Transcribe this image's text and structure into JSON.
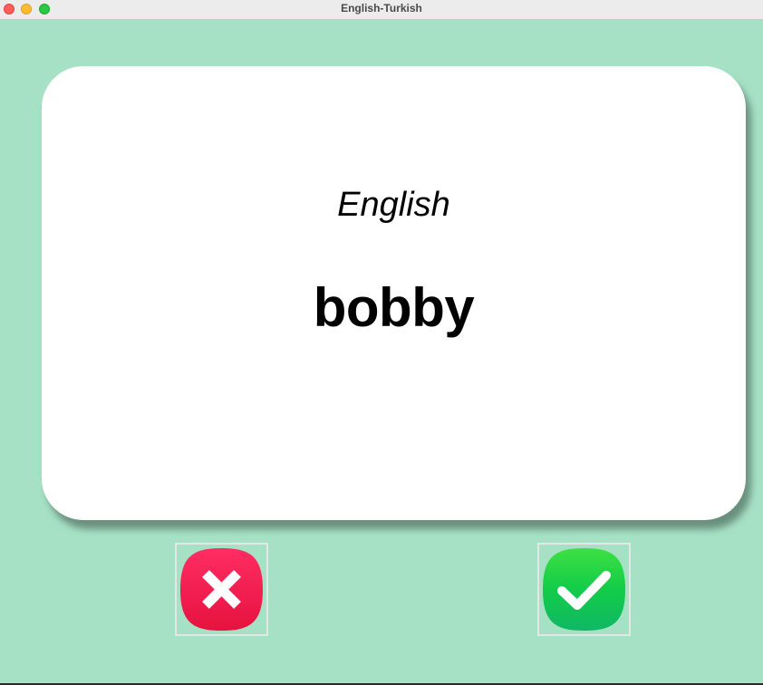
{
  "window": {
    "title": "English-Turkish"
  },
  "card": {
    "language": "English",
    "word": "bobby"
  },
  "buttons": {
    "wrong_icon": "x-mark-icon",
    "right_icon": "checkmark-icon"
  },
  "colors": {
    "background": "#a6e1c6",
    "card": "#ffffff",
    "wrong": "#f0154f",
    "right": "#1fd04a"
  }
}
